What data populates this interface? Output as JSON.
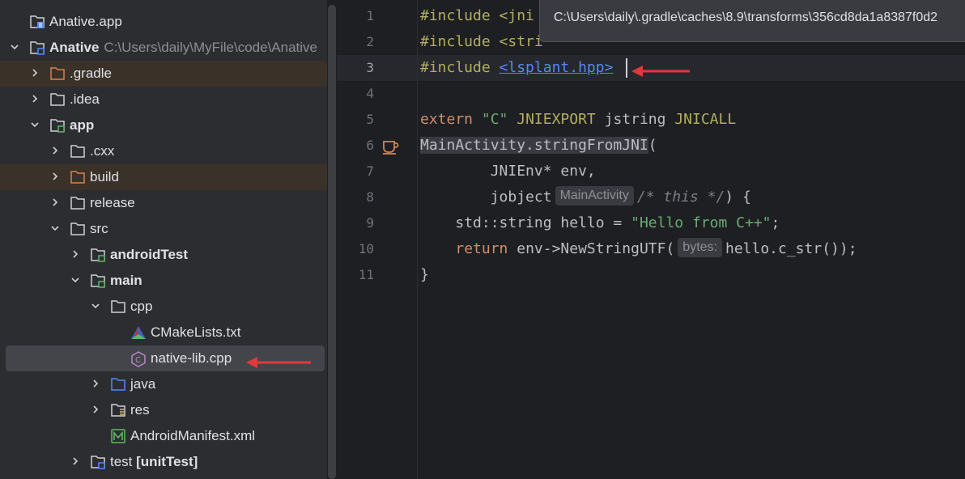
{
  "project_tree": {
    "items": [
      {
        "label": "Anative.app"
      },
      {
        "label": "Anative",
        "path": "C:\\Users\\daily\\MyFile\\code\\Anative"
      },
      {
        "label": ".gradle"
      },
      {
        "label": ".idea"
      },
      {
        "label": "app"
      },
      {
        "label": ".cxx"
      },
      {
        "label": "build"
      },
      {
        "label": "release"
      },
      {
        "label": "src"
      },
      {
        "label": "androidTest"
      },
      {
        "label": "main"
      },
      {
        "label": "cpp"
      },
      {
        "label": "CMakeLists.txt"
      },
      {
        "label": "native-lib.cpp"
      },
      {
        "label": "java"
      },
      {
        "label": "res"
      },
      {
        "label": "AndroidManifest.xml"
      },
      {
        "label": "test",
        "suffix": "[unitTest]"
      }
    ],
    "selected": "native-lib.cpp"
  },
  "editor": {
    "line_numbers": [
      "1",
      "2",
      "3",
      "4",
      "5",
      "6",
      "7",
      "8",
      "9",
      "10",
      "11"
    ],
    "active_line": "3",
    "code": {
      "l1": {
        "directive": "#include",
        "text": "<jni"
      },
      "l2": {
        "directive": "#include",
        "text": "<stri"
      },
      "l3": {
        "directive": "#include",
        "link": "<lsplant.hpp>"
      },
      "l5": {
        "extern": "extern",
        "c_string": "\"C\"",
        "macro1": "JNIEXPORT",
        "type": "jstring",
        "macro2": "JNICALL"
      },
      "l6": {
        "method": "MainActivity.stringFromJNI",
        "paren": "("
      },
      "l7": {
        "text": "JNIEnv* env,"
      },
      "l8": {
        "type": "jobject",
        "hint": "MainActivity",
        "comment": "/* this */",
        "rest": ") {"
      },
      "l9": {
        "pre": "std::string hello = ",
        "string": "\"Hello from C++\"",
        "semi": ";"
      },
      "l10": {
        "keyword": "return",
        "pre": " env->NewStringUTF(",
        "hint": "bytes:",
        "rest": "hello.c_str());"
      },
      "l11": {
        "text": "}"
      }
    },
    "tooltip": "C:\\Users\\daily\\.gradle\\caches\\8.9\\transforms\\356cd8da1a8387f0d2"
  },
  "colors": {
    "annotation_arrow": "#e0393c",
    "background": "#1e1f22",
    "sidebar": "#2b2d30",
    "link": "#548af7"
  }
}
